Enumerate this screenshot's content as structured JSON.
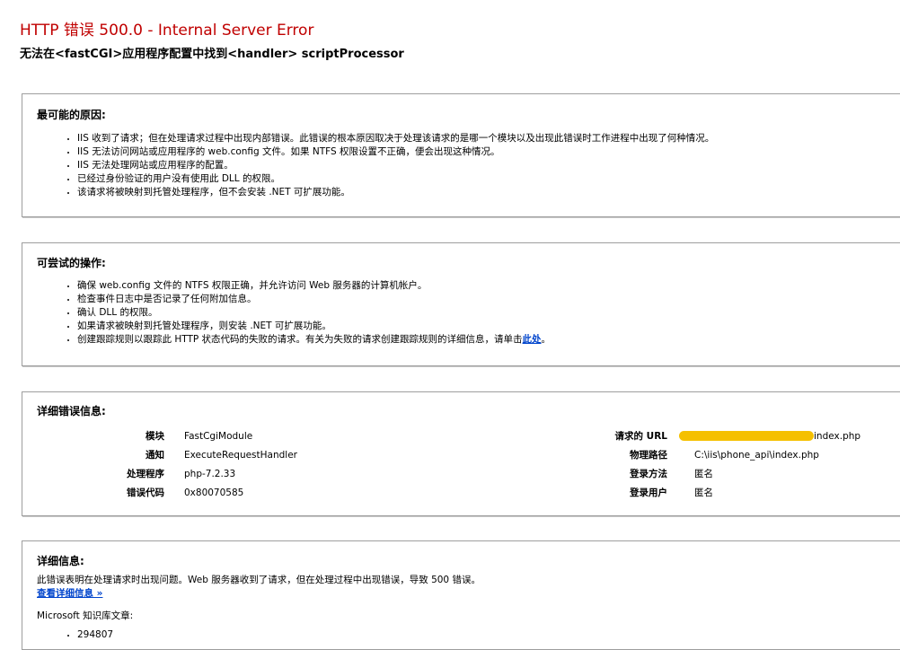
{
  "header": {
    "title": "HTTP 错误 500.0 - Internal Server Error",
    "subtitle": "无法在<fastCGI>应用程序配置中找到<handler> scriptProcessor"
  },
  "causes": {
    "heading": "最可能的原因:",
    "items": [
      "IIS 收到了请求；但在处理请求过程中出现内部错误。此错误的根本原因取决于处理该请求的是哪一个模块以及出现此错误时工作进程中出现了何种情况。",
      "IIS 无法访问网站或应用程序的 web.config 文件。如果 NTFS 权限设置不正确，便会出现这种情况。",
      "IIS 无法处理网站或应用程序的配置。",
      "已经过身份验证的用户没有使用此 DLL 的权限。",
      "该请求将被映射到托管处理程序，但不会安装 .NET 可扩展功能。"
    ]
  },
  "actions": {
    "heading": "可尝试的操作:",
    "items": [
      "确保 web.config 文件的 NTFS 权限正确，并允许访问 Web 服务器的计算机帐户。",
      "检查事件日志中是否记录了任何附加信息。",
      "确认 DLL 的权限。",
      "如果请求被映射到托管处理程序，则安装 .NET 可扩展功能。"
    ],
    "last_item_text": "创建跟踪规则以跟踪此 HTTP 状态代码的失败的请求。有关为失败的请求创建跟踪规则的详细信息，请单击",
    "last_item_link": "此处",
    "last_item_end": "。"
  },
  "detail": {
    "heading": "详细错误信息:",
    "left": [
      {
        "label": "模块",
        "value": "FastCgiModule"
      },
      {
        "label": "通知",
        "value": "ExecuteRequestHandler"
      },
      {
        "label": "处理程序",
        "value": "php-7.2.33"
      },
      {
        "label": "错误代码",
        "value": "0x80070585"
      }
    ],
    "right": [
      {
        "label": "请求的 URL",
        "value": "index.php"
      },
      {
        "label": "物理路径",
        "value": "C:\\iis\\phone_api\\index.php"
      },
      {
        "label": "登录方法",
        "value": "匿名"
      },
      {
        "label": "登录用户",
        "value": "匿名"
      }
    ],
    "redaction_color": "#f5c000"
  },
  "info": {
    "heading": "详细信息:",
    "text": "此错误表明在处理请求时出现问题。Web 服务器收到了请求，但在处理过程中出现错误，导致 500 错误。",
    "more_link": "查看详细信息 »",
    "kb_label": "Microsoft 知识库文章:",
    "kb_items": [
      "294807"
    ]
  },
  "colors": {
    "title": "#c00000",
    "link": "#0044cc",
    "border": "#9e9e9e"
  }
}
